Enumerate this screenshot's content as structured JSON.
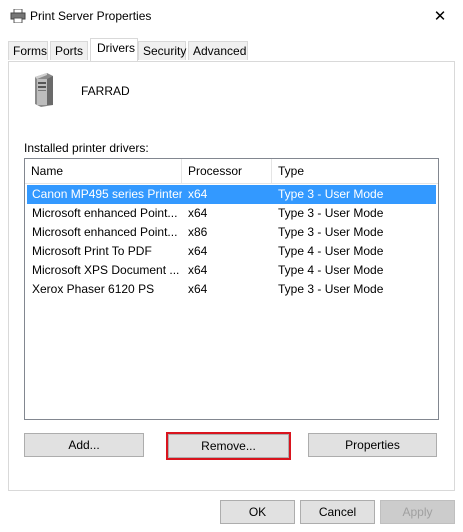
{
  "window": {
    "title": "Print Server Properties",
    "close_glyph": "✕"
  },
  "tabs": [
    {
      "label": "Forms"
    },
    {
      "label": "Ports"
    },
    {
      "label": "Drivers"
    },
    {
      "label": "Security"
    },
    {
      "label": "Advanced"
    }
  ],
  "server": {
    "name": "FARRAD"
  },
  "drivers": {
    "label": "Installed printer drivers:",
    "columns": [
      "Name",
      "Processor",
      "Type"
    ],
    "rows": [
      {
        "name": "Canon MP495 series Printer",
        "processor": "x64",
        "type": "Type 3 - User Mode"
      },
      {
        "name": "Microsoft enhanced Point...",
        "processor": "x64",
        "type": "Type 3 - User Mode"
      },
      {
        "name": "Microsoft enhanced Point...",
        "processor": "x86",
        "type": "Type 3 - User Mode"
      },
      {
        "name": "Microsoft Print To PDF",
        "processor": "x64",
        "type": "Type 4 - User Mode"
      },
      {
        "name": "Microsoft XPS Document ...",
        "processor": "x64",
        "type": "Type 4 - User Mode"
      },
      {
        "name": "Xerox Phaser 6120 PS",
        "processor": "x64",
        "type": "Type 3 - User Mode"
      }
    ]
  },
  "buttons": {
    "add": "Add...",
    "remove": "Remove...",
    "properties": "Properties",
    "ok": "OK",
    "cancel": "Cancel",
    "apply": "Apply"
  },
  "colors": {
    "selection": "#3399ff",
    "highlight_box": "#d9141e"
  }
}
